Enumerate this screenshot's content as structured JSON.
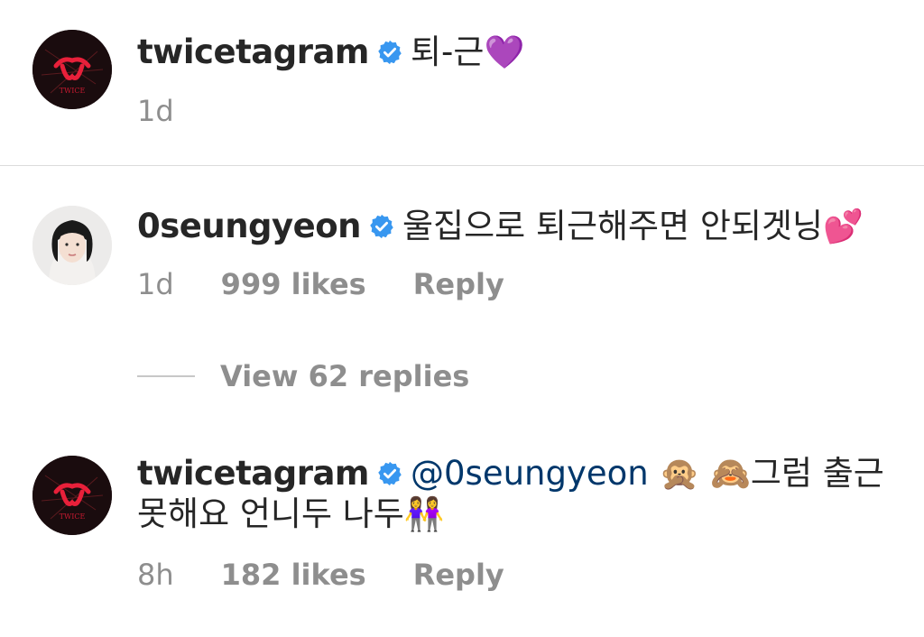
{
  "post": {
    "username": "twicetagram",
    "caption": "퇴-근",
    "caption_emoji": "💜",
    "time": "1d",
    "avatar_text": "TWICE"
  },
  "comments": [
    {
      "username": "0seungyeon",
      "text": "울집으로 퇴근해주면 안되겟닝",
      "emoji": "💕",
      "time": "1d",
      "likes": "999 likes",
      "reply_label": "Reply"
    }
  ],
  "view_replies_label": "View 62 replies",
  "reply": {
    "username": "twicetagram",
    "mention": "@0seungyeon",
    "emoji_1": "🙊",
    "emoji_2": "🙈",
    "text_1": "그럼 출근",
    "text_2": "못해요 언니두 나두",
    "emoji_3": "👭",
    "time": "8h",
    "likes": "182 likes",
    "reply_label": "Reply",
    "avatar_text": "TWICE"
  },
  "colors": {
    "verified_badge": "#3897f0",
    "mention": "#00376b",
    "muted": "#8e8e8e",
    "text": "#262626"
  }
}
